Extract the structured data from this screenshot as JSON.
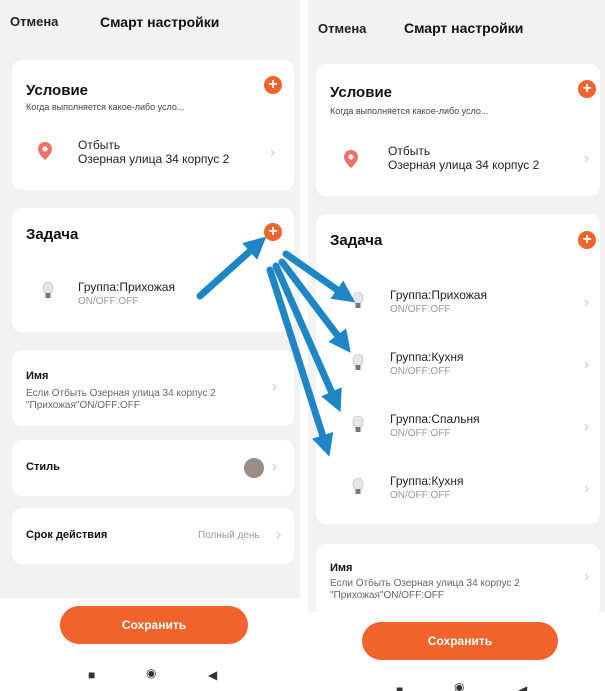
{
  "common": {
    "cancel": "Отмена",
    "title": "Смарт настройки",
    "condition_title": "Условие",
    "condition_sub": "Когда выполняется какое-либо усло...",
    "location_l1": "Отбыть",
    "location_l2": "Озерная улица 34 корпус 2",
    "task_title": "Задача",
    "plus": "+",
    "chevron": "›",
    "name_title": "Имя",
    "name_line1": "Если Отбыть Озерная улица 34 корпус 2",
    "name_line2": "\"Прихожая\"ON/OFF:OFF",
    "save": "Сохранить"
  },
  "left": {
    "tasks": [
      {
        "name": "Группа:Прихожая",
        "state": "ON/OFF:OFF"
      }
    ],
    "style_label": "Стиль",
    "validity_label": "Срок действия",
    "validity_value": "Полный день",
    "nav": {
      "square": "■",
      "circle": "◉",
      "back": "◀"
    }
  },
  "right": {
    "tasks": [
      {
        "name": "Группа:Прихожая",
        "state": "ON/OFF:OFF"
      },
      {
        "name": "Группа:Кухня",
        "state": "ON/OFF:OFF"
      },
      {
        "name": "Группа:Спальня",
        "state": "ON/OFF:OFF"
      },
      {
        "name": "Группа:Кухня",
        "state": "ON/OFF:OFF"
      }
    ]
  },
  "colors": {
    "accent": "#f0642b",
    "arrow": "#1f86c6",
    "pin": "#f07065"
  }
}
